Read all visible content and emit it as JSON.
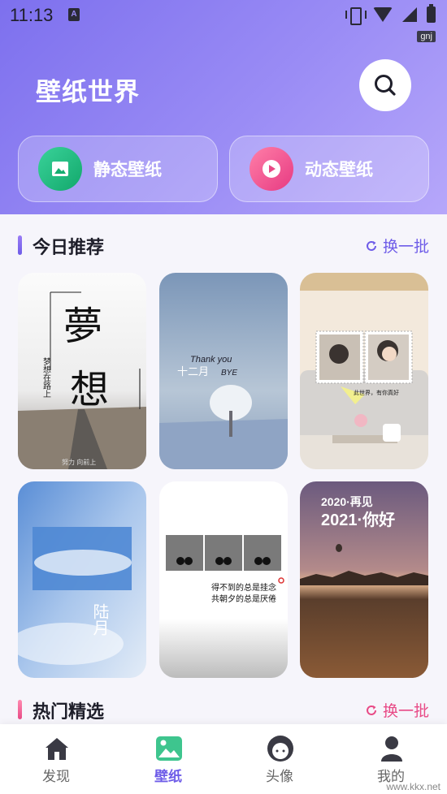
{
  "status_bar": {
    "time": "11:13",
    "notif_letter": "A",
    "overlay_tag": "gnj"
  },
  "header": {
    "title": "壁纸世界"
  },
  "categories": [
    {
      "label": "静态壁纸",
      "icon": "image-icon"
    },
    {
      "label": "动态壁纸",
      "icon": "play-icon"
    }
  ],
  "sections": {
    "today": {
      "title": "今日推荐",
      "refresh_label": "换一批"
    },
    "hot": {
      "title": "热门精选",
      "refresh_label": "换一批"
    }
  },
  "thumbnails": {
    "dream": {
      "big1": "夢",
      "big2": "想",
      "side": "梦想在路上",
      "small": "努力 向前上"
    },
    "winter": {
      "script": "Thank you",
      "text": "十二月",
      "bye": "BYE"
    },
    "couple": {
      "caption": "此世界，有你真好"
    },
    "sky": {
      "text": "陆月"
    },
    "bw": {
      "line1": "得不到的总是挂念",
      "line2": "共朝夕的总是厌倦"
    },
    "newyear": {
      "line1": "2020·再见",
      "line2": "2021·你好"
    }
  },
  "tabbar": {
    "items": [
      {
        "label": "发现",
        "icon": "home-icon"
      },
      {
        "label": "壁纸",
        "icon": "wallpaper-icon"
      },
      {
        "label": "头像",
        "icon": "avatar-icon"
      },
      {
        "label": "我的",
        "icon": "person-icon"
      }
    ],
    "active": "壁纸"
  },
  "watermark": "www.kkx.net",
  "colors": {
    "accent": "#6e5ce8",
    "pink": "#e84a86",
    "header_start": "#7d70ee",
    "header_end": "#b6a7fa"
  }
}
